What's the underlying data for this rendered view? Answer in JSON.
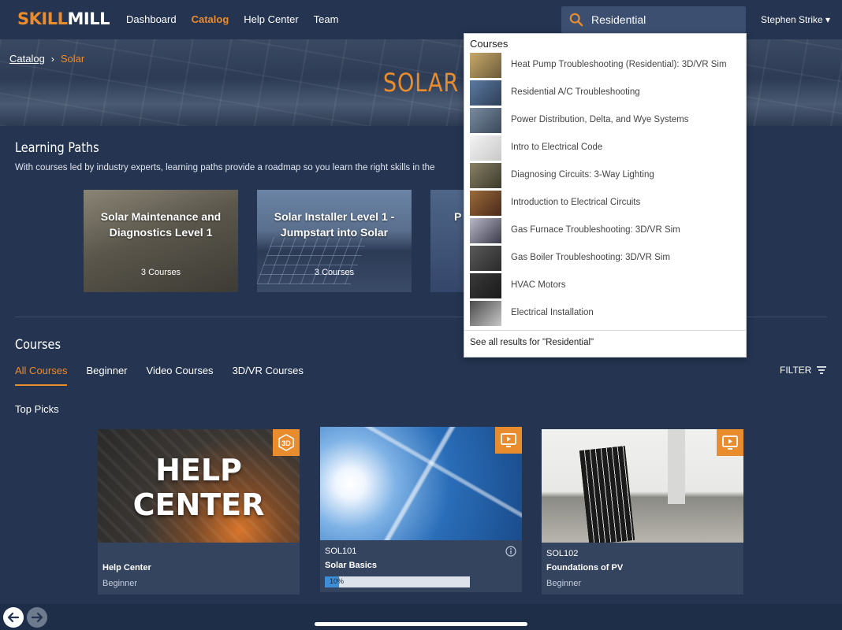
{
  "app": {
    "logo_part1": "SKILL",
    "logo_part2": "MILL"
  },
  "nav": {
    "dashboard": "Dashboard",
    "catalog": "Catalog",
    "help_center": "Help Center",
    "team": "Team"
  },
  "search": {
    "value": "Residential"
  },
  "user": {
    "name": "Stephen Strike ▾"
  },
  "breadcrumb": {
    "parent": "Catalog",
    "separator": "›",
    "current": "Solar"
  },
  "hero": {
    "title": "SOLAR"
  },
  "learning_paths": {
    "title": "Learning Paths",
    "description": "With courses led by industry experts, learning paths provide a roadmap so you learn the right skills in the",
    "cards": [
      {
        "name": "Solar Maintenance and Diagnostics Level 1",
        "count": "3 Courses"
      },
      {
        "name": "Solar Installer Level 1 - Jumpstart into Solar",
        "count": "3 Courses"
      },
      {
        "name": "P"
      }
    ]
  },
  "courses": {
    "title": "Courses",
    "tabs": [
      "All Courses",
      "Beginner",
      "Video Courses",
      "3D/VR Courses"
    ],
    "active_tab": "All Courses",
    "filter_label": "FILTER",
    "top_picks_label": "Top Picks",
    "cards": [
      {
        "thumb_text_1": "HELP",
        "thumb_text_2": "CENTER",
        "badge_icon": "3d-icon",
        "name": "Help Center",
        "level": "Beginner"
      },
      {
        "code": "SOL101",
        "name": "Solar Basics",
        "badge_icon": "video-icon",
        "progress_label": "10%",
        "progress_fraction": 0.1
      },
      {
        "code": "SOL102",
        "name": "Foundations of PV",
        "badge_icon": "video-icon",
        "level": "Beginner"
      }
    ]
  },
  "search_results": {
    "heading": "Courses",
    "items": [
      "Heat Pump Troubleshooting (Residential): 3D/VR Sim",
      "Residential A/C Troubleshooting",
      "Power Distribution, Delta, and Wye Systems",
      "Intro to Electrical Code",
      "Diagnosing Circuits: 3-Way Lighting",
      "Introduction to Electrical Circuits",
      "Gas Furnace Troubleshooting: 3D/VR Sim",
      "Gas Boiler Troubleshooting: 3D/VR Sim",
      "HVAC Motors",
      "Electrical Installation"
    ],
    "see_all": "See all results for \"Residential\""
  },
  "colors": {
    "accent": "#e98c2e",
    "background": "#243451",
    "card": "#34445f"
  }
}
